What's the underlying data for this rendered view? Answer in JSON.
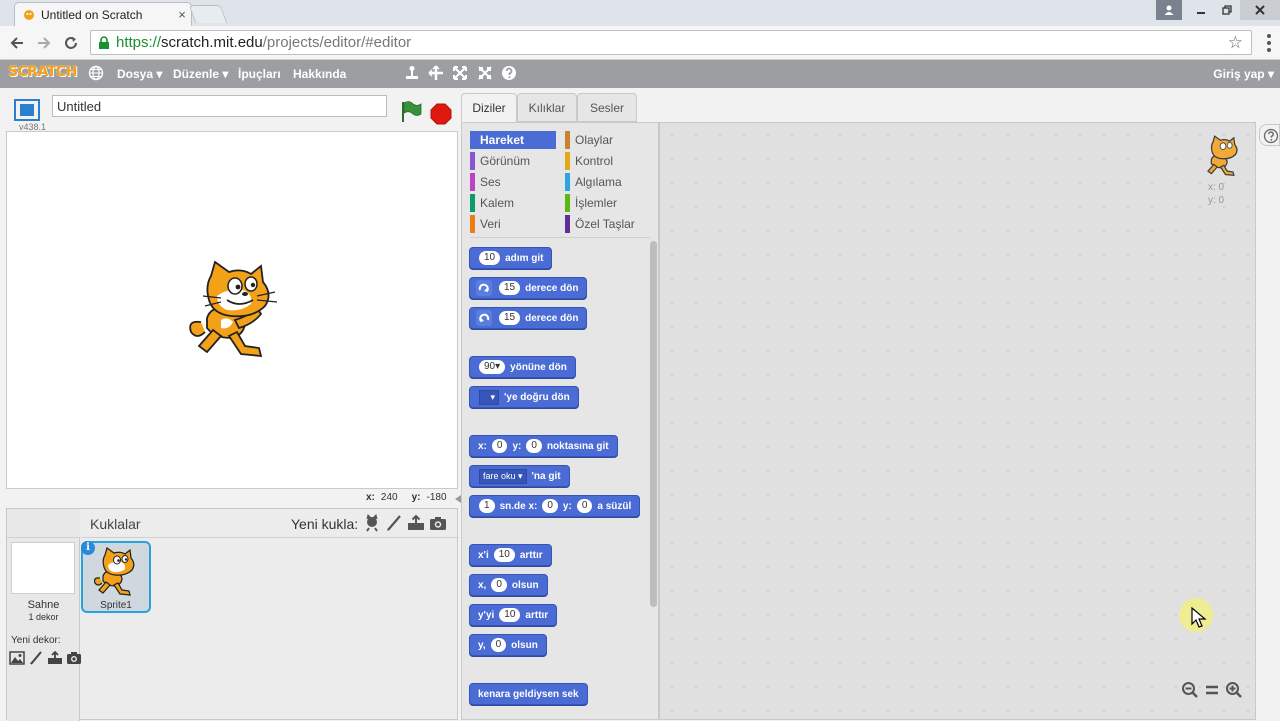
{
  "browser": {
    "tab_title": "Untitled on Scratch",
    "tab_close": "×",
    "url_scheme": "https://",
    "url_host": "scratch.mit.edu",
    "url_path": "/projects/editor/#editor"
  },
  "menubar": {
    "logo": "SCRATCH",
    "file": "Dosya ▾",
    "edit": "Düzenle ▾",
    "tips": "İpuçları",
    "about": "Hakkında",
    "signin": "Giriş yap ▾"
  },
  "stage": {
    "version": "v438.1",
    "project_title": "Untitled",
    "x_label": "x:",
    "x_value": "240",
    "y_label": "y:",
    "y_value": "-180"
  },
  "sprite_pane": {
    "stage_name": "Sahne",
    "stage_backdrops": "1 dekor",
    "new_backdrop": "Yeni dekor:",
    "sprites_title": "Kuklalar",
    "new_sprite": "Yeni kukla:",
    "sprite_info": "i",
    "sprite_name": "Sprite1"
  },
  "tabs": [
    "Diziler",
    "Kılıklar",
    "Sesler"
  ],
  "categories": [
    {
      "label": "Hareket",
      "color": "#4a6cd4"
    },
    {
      "label": "Görünüm",
      "color": "#8a55d7"
    },
    {
      "label": "Ses",
      "color": "#bb42c3"
    },
    {
      "label": "Kalem",
      "color": "#0e9a6c"
    },
    {
      "label": "Veri",
      "color": "#ee7d16"
    },
    {
      "label": "Olaylar",
      "color": "#c88330"
    },
    {
      "label": "Kontrol",
      "color": "#e1a91a"
    },
    {
      "label": "Algılama",
      "color": "#2ca5e2"
    },
    {
      "label": "İşlemler",
      "color": "#5cb712"
    },
    {
      "label": "Özel Taşlar",
      "color": "#632d99"
    }
  ],
  "blocks": {
    "move": {
      "num": "10",
      "text": "adım git"
    },
    "turn_right": {
      "num": "15",
      "text": "derece dön"
    },
    "turn_left": {
      "num": "15",
      "text": "derece dön"
    },
    "point_dir": {
      "num": "90▾",
      "text": "yönüne dön"
    },
    "point_towards": {
      "drop": "▾",
      "text": "'ye doğru dön"
    },
    "goto_xy": {
      "x_label": "x:",
      "x": "0",
      "y_label": "y:",
      "y": "0",
      "text": "noktasına git"
    },
    "goto": {
      "drop": "fare oku ▾",
      "text": "'na git"
    },
    "glide": {
      "secs": "1",
      "t1": "sn.de x:",
      "x": "0",
      "t2": "y:",
      "y": "0",
      "t3": "a süzül"
    },
    "change_x": {
      "label": "x'i",
      "num": "10",
      "text": "arttır"
    },
    "set_x": {
      "label": "x,",
      "num": "0",
      "text": "olsun"
    },
    "change_y": {
      "label": "y'yi",
      "num": "10",
      "text": "arttır"
    },
    "set_y": {
      "label": "y,",
      "num": "0",
      "text": "olsun"
    },
    "bounce": {
      "text": "kenara geldiysen sek"
    }
  },
  "script_area": {
    "x_readout": "x: 0",
    "y_readout": "y: 0"
  }
}
